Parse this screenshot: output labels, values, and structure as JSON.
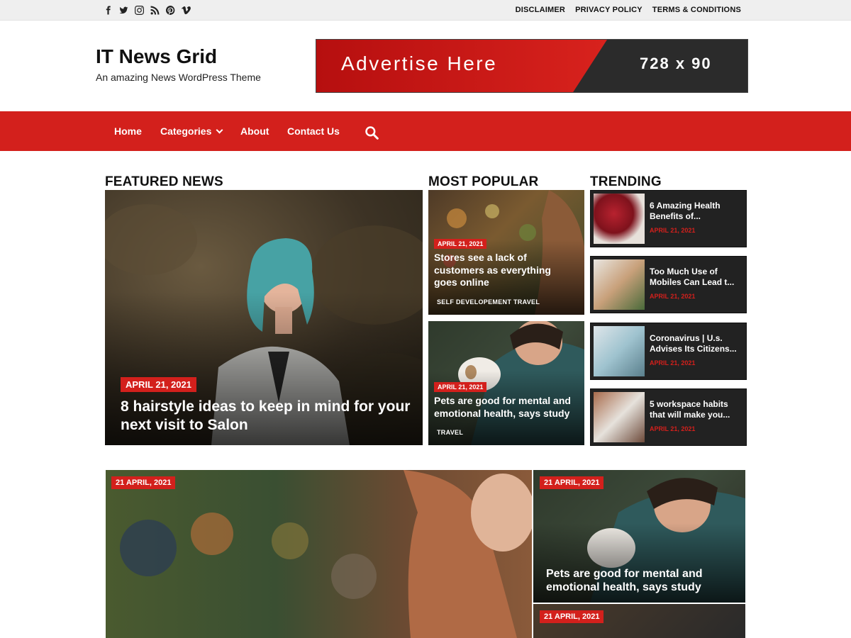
{
  "topbar": {
    "social_icons": [
      "facebook-icon",
      "twitter-icon",
      "instagram-icon",
      "rss-icon",
      "pinterest-icon",
      "vimeo-icon"
    ],
    "links": [
      "DISCLAIMER",
      "PRIVACY POLICY",
      "TERMS & CONDITIONS"
    ]
  },
  "header": {
    "site_title": "IT News Grid",
    "tagline": "An amazing News WordPress Theme",
    "ad_text": "Advertise Here",
    "ad_size": "728 x 90"
  },
  "nav": {
    "items": [
      "Home",
      "Categories",
      "About",
      "Contact Us"
    ],
    "search_icon": "search-icon"
  },
  "sections": {
    "featured": "FEATURED NEWS",
    "popular": "MOST POPULAR",
    "trending": "TRENDING"
  },
  "featured": {
    "date": "APRIL 21, 2021",
    "title": "8 hairstyle ideas to keep in mind for your next visit to Salon"
  },
  "popular": [
    {
      "date": "APRIL 21, 2021",
      "title": "Stores see a lack of customers as everything goes online",
      "cats": [
        "SELF DEVELOPEMENT",
        "TRAVEL"
      ]
    },
    {
      "date": "APRIL 21, 2021",
      "title": "Pets are good for mental and emotional health, says study",
      "cats": [
        "TRAVEL"
      ]
    }
  ],
  "trending": [
    {
      "title": "6 Amazing Health Benefits of...",
      "date": "APRIL 21, 2021"
    },
    {
      "title": "Too Much Use of Mobiles Can Lead t...",
      "date": "APRIL 21, 2021"
    },
    {
      "title": "Coronavirus | U.s. Advises Its Citizens...",
      "date": "APRIL 21, 2021"
    },
    {
      "title": "5 workspace habits that will make you...",
      "date": "APRIL 21, 2021"
    }
  ],
  "bottom": [
    {
      "date": "21 APRIL, 2021"
    },
    {
      "date": "21 APRIL, 2021",
      "title": "Pets are good for mental and emotional health, says study"
    },
    {
      "date": "21 APRIL, 2021"
    }
  ],
  "colors": {
    "accent": "#d3201c",
    "dark": "#222222",
    "topbar": "#efefef"
  }
}
